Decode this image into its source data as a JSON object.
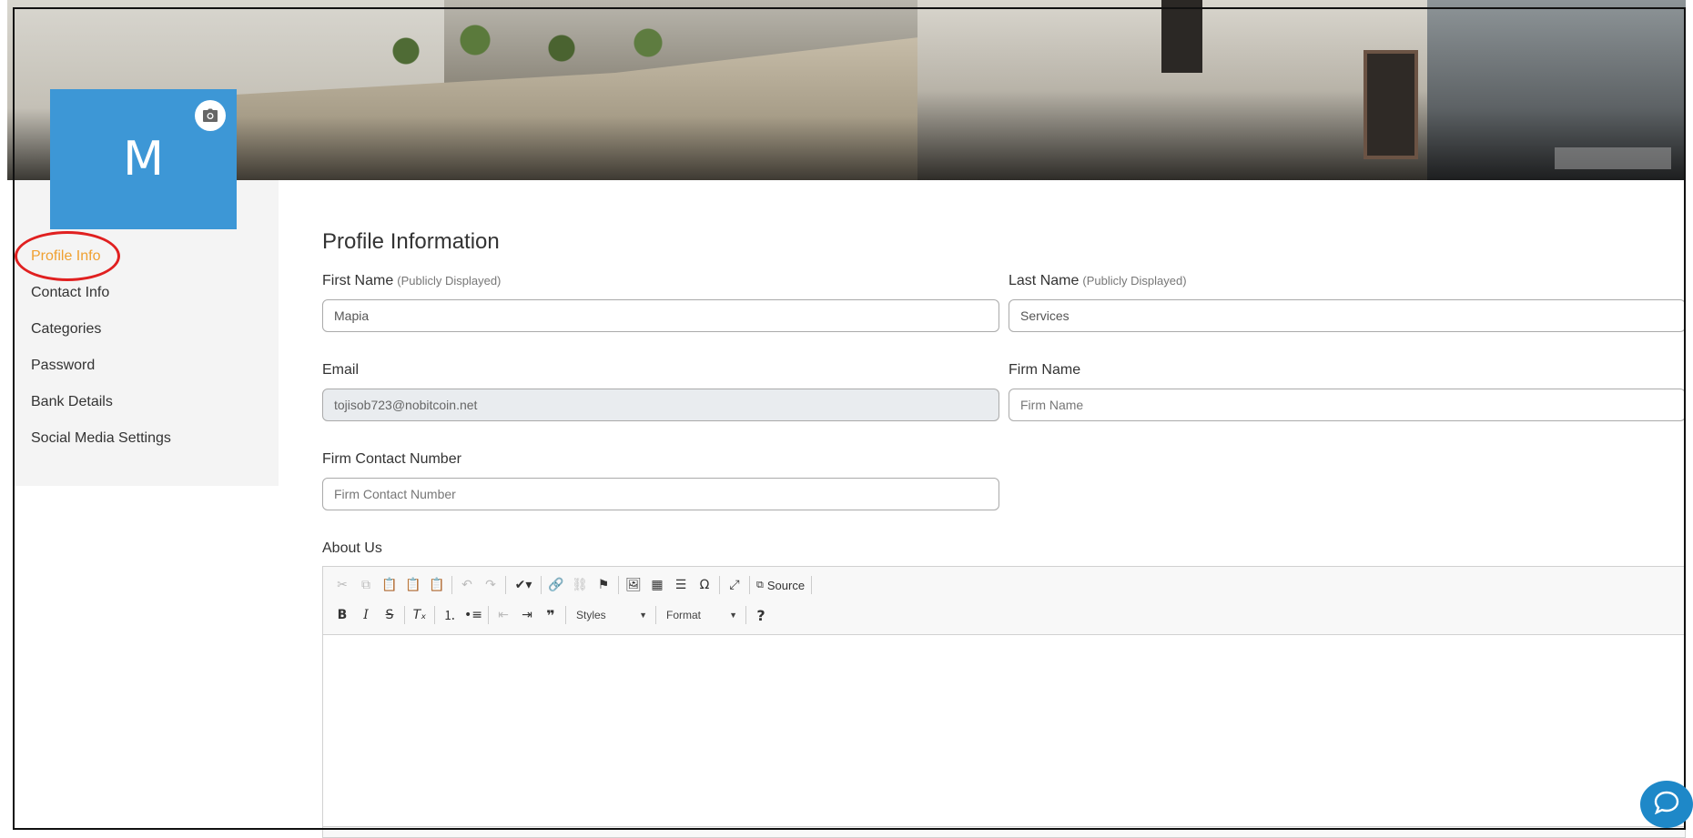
{
  "banner": {
    "change_cover_label": ""
  },
  "avatar": {
    "initial": "M"
  },
  "sidebar": {
    "items": [
      {
        "label": "Profile Info",
        "active": true
      },
      {
        "label": "Contact Info"
      },
      {
        "label": "Categories"
      },
      {
        "label": "Password"
      },
      {
        "label": "Bank Details"
      },
      {
        "label": "Social Media Settings"
      }
    ]
  },
  "form": {
    "title": "Profile Information",
    "first_name": {
      "label": "First Name",
      "note": "(Publicly Displayed)",
      "value": "Mapia"
    },
    "last_name": {
      "label": "Last Name",
      "note": "(Publicly Displayed)",
      "value": "Services"
    },
    "email": {
      "label": "Email",
      "value": "tojisob723@nobitcoin.net"
    },
    "firm_name": {
      "label": "Firm Name",
      "placeholder": "Firm Name"
    },
    "firm_contact": {
      "label": "Firm Contact Number",
      "placeholder": "Firm Contact Number"
    },
    "about": {
      "label": "About Us"
    }
  },
  "editor": {
    "source_label": "Source",
    "styles_label": "Styles",
    "format_label": "Format"
  },
  "colors": {
    "accent": "#f0a030",
    "avatar": "#3d97d6",
    "highlight": "#e02020",
    "chat": "#1e88c8"
  }
}
